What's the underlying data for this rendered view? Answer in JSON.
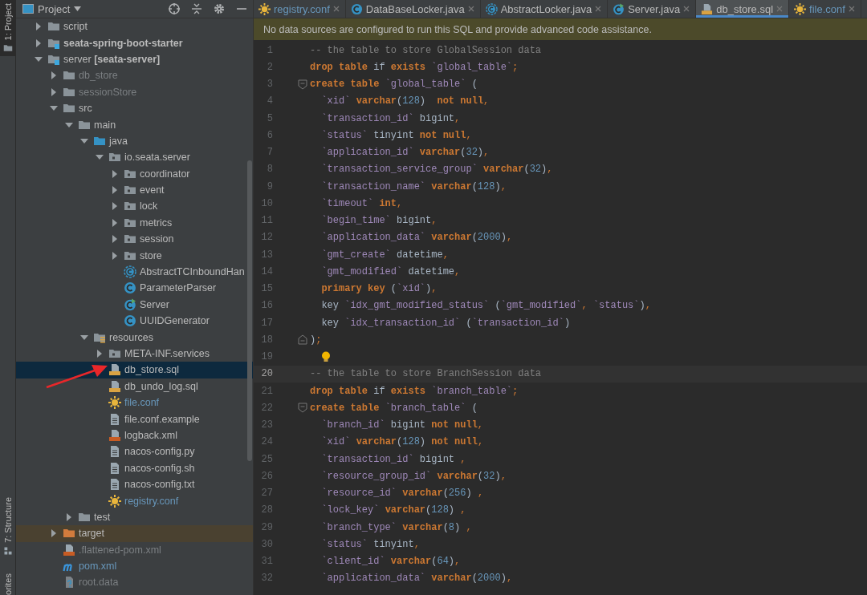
{
  "stripe_top": [
    {
      "label": "1: Project",
      "kind": "folder",
      "selected": true
    }
  ],
  "stripe_bottom": [
    {
      "label": "7: Structure",
      "kind": "structure",
      "selected": false
    },
    {
      "label": "orites",
      "selected": false
    }
  ],
  "project_panel": {
    "title": "Project"
  },
  "tree": [
    {
      "label": "script",
      "kind": "folder",
      "expanded": false,
      "selected": false,
      "color": "#bbbbbb"
    },
    {
      "label": "seata-spring-boot-starter",
      "kind": "module",
      "bold": true,
      "expanded": false,
      "selected": false,
      "color": "#bbbbbb"
    },
    {
      "label": "server **[seata-server]**",
      "kind": "module",
      "expanded": true,
      "selected": false,
      "color": "#bbbbbb",
      "children": [
        {
          "label": "db_store",
          "kind": "folder",
          "expanded": false,
          "selected": false,
          "color": "#7b7f82"
        },
        {
          "label": "sessionStore",
          "kind": "folder",
          "expanded": false,
          "selected": false,
          "color": "#7b7f82"
        },
        {
          "label": "src",
          "kind": "folder",
          "expanded": true,
          "selected": false,
          "color": "#bbbbbb",
          "children": [
            {
              "label": "main",
              "kind": "folder",
              "expanded": true,
              "selected": false,
              "color": "#bbbbbb",
              "children": [
                {
                  "label": "java",
                  "kind": "source-root",
                  "expanded": true,
                  "selected": false,
                  "color": "#bbbbbb",
                  "children": [
                    {
                      "label": "io.seata.server",
                      "kind": "package",
                      "expanded": true,
                      "selected": false,
                      "color": "#bbbbbb",
                      "children": [
                        {
                          "label": "coordinator",
                          "kind": "package",
                          "expanded": false,
                          "selected": false,
                          "color": "#bbbbbb"
                        },
                        {
                          "label": "event",
                          "kind": "package",
                          "expanded": false,
                          "selected": false,
                          "color": "#bbbbbb"
                        },
                        {
                          "label": "lock",
                          "kind": "package",
                          "expanded": false,
                          "selected": false,
                          "color": "#bbbbbb"
                        },
                        {
                          "label": "metrics",
                          "kind": "package",
                          "expanded": false,
                          "selected": false,
                          "color": "#bbbbbb"
                        },
                        {
                          "label": "session",
                          "kind": "package",
                          "expanded": false,
                          "selected": false,
                          "color": "#bbbbbb"
                        },
                        {
                          "label": "store",
                          "kind": "package",
                          "expanded": false,
                          "selected": false,
                          "color": "#bbbbbb"
                        },
                        {
                          "label": "AbstractTCInboundHan",
                          "kind": "abstract-class",
                          "selected": false,
                          "color": "#bbbbbb"
                        },
                        {
                          "label": "ParameterParser",
                          "kind": "class",
                          "selected": false,
                          "color": "#bbbbbb"
                        },
                        {
                          "label": "Server",
                          "kind": "main-class",
                          "selected": false,
                          "color": "#bbbbbb"
                        },
                        {
                          "label": "UUIDGenerator",
                          "kind": "class",
                          "selected": false,
                          "color": "#bbbbbb"
                        }
                      ]
                    }
                  ]
                },
                {
                  "label": "resources",
                  "kind": "resources-root",
                  "expanded": true,
                  "selected": false,
                  "color": "#bbbbbb",
                  "children": [
                    {
                      "label": "META-INF.services",
                      "kind": "package",
                      "expanded": false,
                      "selected": false,
                      "color": "#bbbbbb"
                    },
                    {
                      "label": "db_store.sql",
                      "kind": "sql",
                      "selected": true,
                      "color": "#bbbbbb"
                    },
                    {
                      "label": "db_undo_log.sql",
                      "kind": "sql",
                      "selected": false,
                      "color": "#bbbbbb"
                    },
                    {
                      "label": "file.conf",
                      "kind": "conf",
                      "selected": false,
                      "color": "#6897bb"
                    },
                    {
                      "label": "file.conf.example",
                      "kind": "text",
                      "selected": false,
                      "color": "#bbbbbb"
                    },
                    {
                      "label": "logback.xml",
                      "kind": "xml",
                      "selected": false,
                      "color": "#bbbbbb"
                    },
                    {
                      "label": "nacos-config.py",
                      "kind": "text",
                      "selected": false,
                      "color": "#bbbbbb"
                    },
                    {
                      "label": "nacos-config.sh",
                      "kind": "text",
                      "selected": false,
                      "color": "#bbbbbb"
                    },
                    {
                      "label": "nacos-config.txt",
                      "kind": "text",
                      "selected": false,
                      "color": "#bbbbbb"
                    },
                    {
                      "label": "registry.conf",
                      "kind": "conf",
                      "selected": false,
                      "color": "#6897bb"
                    }
                  ]
                }
              ]
            },
            {
              "label": "test",
              "kind": "folder",
              "expanded": false,
              "selected": false,
              "color": "#bbbbbb"
            }
          ]
        },
        {
          "label": "target",
          "kind": "excluded-folder",
          "expanded": false,
          "selected": false,
          "color": "#bbbbbb"
        },
        {
          "label": ".flattened-pom.xml",
          "kind": "xml",
          "selected": false,
          "color": "#7b7f82"
        },
        {
          "label": "pom.xml",
          "kind": "maven",
          "selected": false,
          "color": "#6897bb"
        },
        {
          "label": "root.data",
          "kind": "unknown",
          "selected": false,
          "color": "#7b7f82"
        }
      ]
    }
  ],
  "pointer_arrow": {
    "kind": "arrow"
  },
  "tabs": [
    {
      "label": "registry.conf",
      "kind": "conf",
      "color": "#6897bb",
      "selected": false
    },
    {
      "label": "DataBaseLocker.java",
      "kind": "class",
      "color": "#bbbbbb",
      "selected": false
    },
    {
      "label": "AbstractLocker.java",
      "kind": "abstract-class",
      "color": "#bbbbbb",
      "selected": false
    },
    {
      "label": "Server.java",
      "kind": "main-class",
      "color": "#bbbbbb",
      "selected": false
    },
    {
      "label": "db_store.sql",
      "kind": "sql",
      "color": "#bbbbbb",
      "selected": true
    },
    {
      "label": "file.conf",
      "kind": "conf",
      "color": "#6897bb",
      "selected": false
    }
  ],
  "banner": {
    "message": "No data sources are configured to run this SQL and provide advanced code assistance."
  },
  "lines": [
    {
      "number": "1",
      "kind": "comment",
      "current": false,
      "text": "-- the table to store GlobalSession data"
    },
    {
      "number": "2",
      "kind": "code",
      "current": false,
      "text": "**drop table** if **exists** `global_table`;"
    },
    {
      "number": "3",
      "kind": "code",
      "current": false,
      "fold": {
        "kind": "start"
      },
      "text": "**create table** `global_table` ("
    },
    {
      "number": "4",
      "kind": "code",
      "current": false,
      "text": "  `xid` **varchar**(128)  **not null**,"
    },
    {
      "number": "5",
      "kind": "code",
      "current": false,
      "text": "  `transaction_id` bigint,"
    },
    {
      "number": "6",
      "kind": "code",
      "current": false,
      "text": "  `status` tinyint **not null**,"
    },
    {
      "number": "7",
      "kind": "code",
      "current": false,
      "text": "  `application_id` **varchar**(32),"
    },
    {
      "number": "8",
      "kind": "code",
      "current": false,
      "text": "  `transaction_service_group` **varchar**(32),"
    },
    {
      "number": "9",
      "kind": "code",
      "current": false,
      "text": "  `transaction_name` **varchar**(128),"
    },
    {
      "number": "10",
      "kind": "code",
      "current": false,
      "text": "  `timeout` **int**,"
    },
    {
      "number": "11",
      "kind": "code",
      "current": false,
      "text": "  `begin_time` bigint,"
    },
    {
      "number": "12",
      "kind": "code",
      "current": false,
      "text": "  `application_data` **varchar**(2000),"
    },
    {
      "number": "13",
      "kind": "code",
      "current": false,
      "text": "  `gmt_create` datetime,"
    },
    {
      "number": "14",
      "kind": "code",
      "current": false,
      "text": "  `gmt_modified` datetime,"
    },
    {
      "number": "15",
      "kind": "code",
      "current": false,
      "text": "  **primary key** (`xid`),"
    },
    {
      "number": "16",
      "kind": "code",
      "current": false,
      "text": "  key `idx_gmt_modified_status` (`gmt_modified`, `status`),"
    },
    {
      "number": "17",
      "kind": "code",
      "current": false,
      "text": "  key `idx_transaction_id` (`transaction_id`)"
    },
    {
      "number": "18",
      "kind": "code",
      "current": false,
      "fold": {
        "kind": "end"
      },
      "text": ");"
    },
    {
      "number": "19",
      "current": false,
      "bulb": true
    },
    {
      "number": "20",
      "kind": "comment",
      "current": true,
      "text": "-- the table to store BranchSession data"
    },
    {
      "number": "21",
      "kind": "code",
      "current": false,
      "text": "**drop table** if **exists** `branch_table`;"
    },
    {
      "number": "22",
      "kind": "code",
      "current": false,
      "fold": {
        "kind": "start"
      },
      "text": "**create table** `branch_table` ("
    },
    {
      "number": "23",
      "kind": "code",
      "current": false,
      "text": "  `branch_id` bigint **not null**,"
    },
    {
      "number": "24",
      "kind": "code",
      "current": false,
      "text": "  `xid` **varchar**(128) **not null**,"
    },
    {
      "number": "25",
      "kind": "code",
      "current": false,
      "text": "  `transaction_id` bigint ,"
    },
    {
      "number": "26",
      "kind": "code",
      "current": false,
      "text": "  `resource_group_id` **varchar**(32),"
    },
    {
      "number": "27",
      "kind": "code",
      "current": false,
      "text": "  `resource_id` **varchar**(256) ,"
    },
    {
      "number": "28",
      "kind": "code",
      "current": false,
      "text": "  `lock_key` **varchar**(128) ,"
    },
    {
      "number": "29",
      "kind": "code",
      "current": false,
      "text": "  `branch_type` **varchar**(8) ,"
    },
    {
      "number": "30",
      "kind": "code",
      "current": false,
      "text": "  `status` tinyint,"
    },
    {
      "number": "31",
      "kind": "code",
      "current": false,
      "text": "  `client_id` **varchar**(64),"
    },
    {
      "number": "32",
      "kind": "code",
      "current": false,
      "text": "  `application_data` **varchar**(2000),"
    }
  ]
}
